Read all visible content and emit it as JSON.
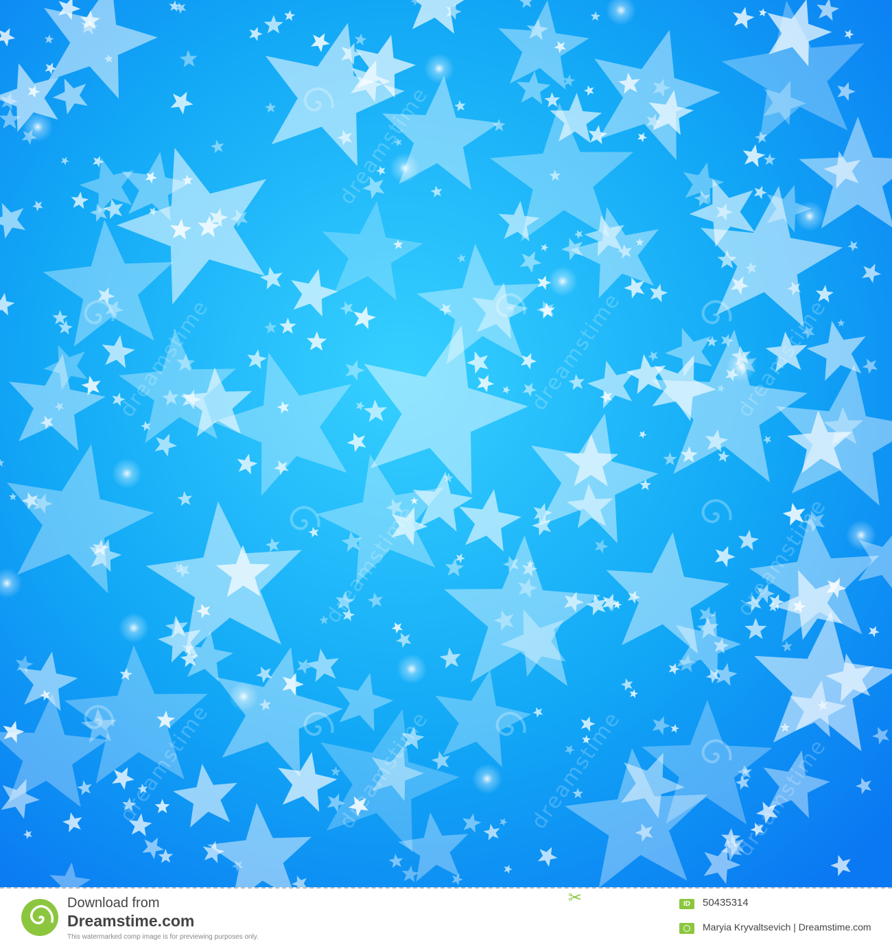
{
  "background": {
    "gradient_center": "#33ccff",
    "gradient_edge": "#0a78f2",
    "star_color": "#ffffff",
    "watermark_text": "dreamstime"
  },
  "footer": {
    "download_line": "Download from",
    "brand": "Dreamstime.com",
    "note": "This watermarked comp image is for previewing purposes only.",
    "id_label": "ID",
    "image_id": "50435314",
    "credit": "Maryia Kryvaltsevich | Dreamstime.com",
    "accent_color": "#8cc63f"
  }
}
